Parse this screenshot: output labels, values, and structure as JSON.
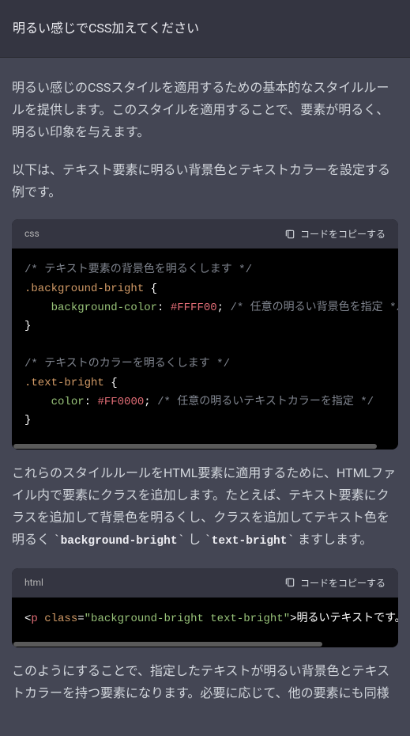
{
  "user_message": "明るい感じでCSS加えてください",
  "assistant": {
    "para1": "明るい感じのCSSスタイルを適用するための基本的なスタイルルールを提供します。このスタイルを適用することで、要素が明るく、明るい印象を与えます。",
    "para2": "以下は、テキスト要素に明るい背景色とテキストカラーを設定する例です。",
    "para3_pre": "これらのスタイルルールをHTML要素に適用するために、HTMLファイル内で要素にクラスを追加します。たとえば、テキスト要素にクラスを追加して背景色を明るくし、クラスを追加してテキスト色を明るく ",
    "para3_code1": "background-bright",
    "para3_mid": " し ",
    "para3_code2": "text-bright",
    "para3_end": " ますします。",
    "para4": "このようにすることで、指定したテキストが明るい背景色とテキストカラーを持つ要素になります。必要に応じて、他の要素にも同様"
  },
  "code": {
    "css_lang": "css",
    "html_lang": "html",
    "copy_label": "コードをコピーする",
    "css": {
      "comment1": "/* テキスト要素の背景色を明るくします */",
      "selector1": ".background-bright",
      "prop1": "background-color",
      "value1": "#FFFF00",
      "comment1b": "/* 任意の明るい背景色を指定 */",
      "comment2": "/* テキストのカラーを明るくします */",
      "selector2": ".text-bright",
      "prop2": "color",
      "value2": "#FF0000",
      "comment2b": "/* 任意の明るいテキストカラーを指定 */"
    },
    "html_sample": {
      "tag": "p",
      "attr": "class",
      "attr_value": "background-bright text-bright",
      "text": "明るいテキストです。"
    }
  },
  "chart_data": null
}
